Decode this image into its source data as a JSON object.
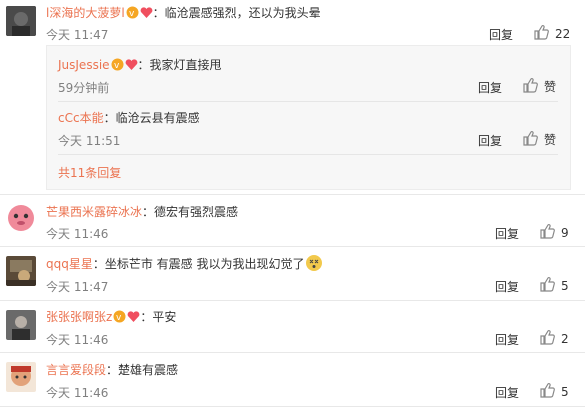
{
  "comments": [
    {
      "username": "l深海的大菠萝l",
      "text": "：临沧震感强烈，还以为我头晕",
      "time": "今天 11:47",
      "reply_label": "回复",
      "likes": "22"
    },
    {
      "username": "芒果西米露碎冰冰",
      "text": "：德宏有强烈震感",
      "time": "今天 11:46",
      "reply_label": "回复",
      "likes": "9"
    },
    {
      "username": "qqq星星",
      "text": "：坐标芒市 有震感 我以为我出现幻觉了",
      "time": "今天 11:47",
      "reply_label": "回复",
      "likes": "5"
    },
    {
      "username": "张张张啊张z",
      "text": "：平安",
      "time": "今天 11:46",
      "reply_label": "回复",
      "likes": "2"
    },
    {
      "username": "言言爱段段",
      "text": "：楚雄有震感",
      "time": "今天 11:46",
      "reply_label": "回复",
      "likes": "5"
    }
  ],
  "subreplies": [
    {
      "username": "JusJessie",
      "text": "：我家灯直接甩",
      "time": "59分钟前",
      "reply_label": "回复",
      "likes": "赞"
    },
    {
      "username": "cCc本能",
      "text": "：临沧云县有震感",
      "time": "今天 11:51",
      "reply_label": "回复",
      "likes": "赞"
    }
  ],
  "more_replies": "共11条回复",
  "colors": {
    "username": "#eb7350",
    "meta": "#808080",
    "panel_bg": "#f7f7f7",
    "badge": "#f5a623"
  },
  "icons": {
    "like": "thumbs-up-icon",
    "member_badge": "vip-badge-icon",
    "emoji": "dizzy-face-emoji"
  }
}
